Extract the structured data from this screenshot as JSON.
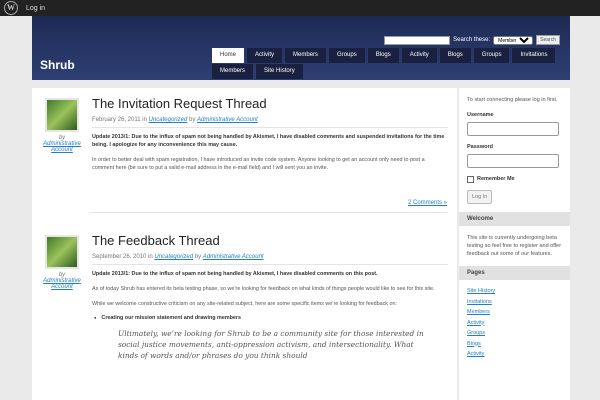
{
  "admin_bar": {
    "logo": "W",
    "login_label": "Log in"
  },
  "header": {
    "site_title": "Shrub",
    "search": {
      "label": "Search these:",
      "select_value": "Members",
      "button_label": "Search",
      "placeholder": ""
    },
    "nav_row1": [
      "Home",
      "Activity",
      "Members",
      "Groups",
      "Blogs",
      "Activity",
      "Blogs",
      "Groups",
      "Invitations"
    ],
    "nav_row2": [
      "Members",
      "Site History"
    ]
  },
  "posts": [
    {
      "title": "The Invitation Request Thread",
      "author_by": "by",
      "author": "Administrative Account",
      "date": "February 26, 2011",
      "meta_in": "in",
      "category": "Uncategorized",
      "meta_by": "by",
      "paragraphs": [
        "Update 2013/1: Due to the influx of spam not being handled by Akismet, I have disabled comments and suspended invitations for the time being. I apologize for any inconvenience this may cause.",
        "In order to better deal with spam registration, I have introduced an invite code system. Anyone looking to get an account only need to post a comment here (be sure to put a valid e-mail address in the e-mail field) and I will sent you an invite."
      ],
      "comments": "2 Comments »"
    },
    {
      "title": "The Feedback Thread",
      "author_by": "by",
      "author": "Administrative Account",
      "date": "September 26, 2010",
      "meta_in": "in",
      "category": "Uncategorized",
      "meta_by": "by",
      "paragraphs": [
        "Update 2013/1: Due to the influx of spam not being handled by Akismet, I have disabled comments on this post.",
        "As of today Shrub has entered its beta testing phase, so we’re looking for feedback on what kinds of things people would like to see for this site.",
        "While we welcome constructive criticism on any site-related subject, here are some specific items we’re looking for feedback on:"
      ],
      "bullet": "Creating our mission statement and drawing members",
      "quote": "Ultimately, we’re looking for Shrub to be a community site for those interested in social justice movements, anti-oppression activism, and intersectionality. What kinds of words and/or phrases do you think should"
    }
  ],
  "sidebar": {
    "intro": "To start connecting please log in first.",
    "username_label": "Username",
    "password_label": "Password",
    "remember_label": "Remember Me",
    "login_button": "Log In",
    "welcome_heading": "Welcome",
    "welcome_text": "This site is currently undergoing beta testing so feel free to register and offer feedback out some of our features.",
    "pages_heading": "Pages",
    "pages": [
      "Site History",
      "Invitations",
      "Members",
      "Activity",
      "Groups",
      "Blogs",
      "Activity"
    ]
  }
}
